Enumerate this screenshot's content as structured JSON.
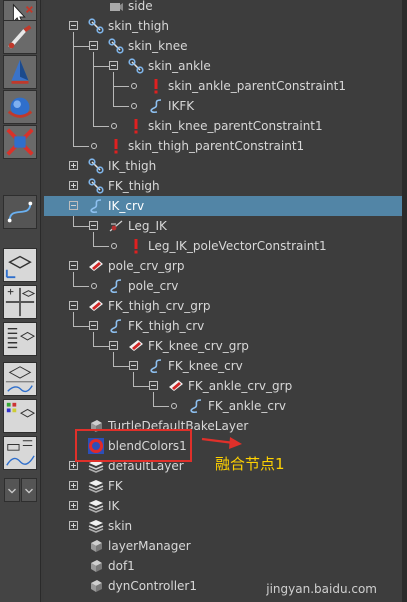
{
  "colors": {
    "panel_bg": "#3d3d3d",
    "selection": "#5285a6",
    "annotation_red": "#e0302a",
    "annotation_yellow": "#ffd200"
  },
  "outliner": {
    "rows": [
      {
        "label": "side",
        "icon": "camera-icon"
      },
      {
        "label": "skin_thigh",
        "icon": "joint-icon",
        "expanded": true
      },
      {
        "label": "skin_knee",
        "icon": "joint-icon",
        "expanded": true
      },
      {
        "label": "skin_ankle",
        "icon": "joint-icon",
        "expanded": true
      },
      {
        "label": "skin_ankle_parentConstraint1",
        "icon": "constraint-icon"
      },
      {
        "label": "IKFK",
        "icon": "curve-icon"
      },
      {
        "label": "skin_knee_parentConstraint1",
        "icon": "constraint-icon"
      },
      {
        "label": "skin_thigh_parentConstraint1",
        "icon": "constraint-icon"
      },
      {
        "label": "IK_thigh",
        "icon": "joint-icon",
        "expanded": false
      },
      {
        "label": "FK_thigh",
        "icon": "joint-icon",
        "expanded": false
      },
      {
        "label": "IK_crv",
        "icon": "curve-icon",
        "expanded": true,
        "selected": true
      },
      {
        "label": "Leg_IK",
        "icon": "ik-handle-icon",
        "expanded": true
      },
      {
        "label": "Leg_IK_poleVectorConstraint1",
        "icon": "constraint-icon"
      },
      {
        "label": "pole_crv_grp",
        "icon": "group-icon",
        "expanded": true
      },
      {
        "label": "pole_crv",
        "icon": "curve-icon"
      },
      {
        "label": "FK_thigh_crv_grp",
        "icon": "group-icon",
        "expanded": true
      },
      {
        "label": "FK_thigh_crv",
        "icon": "curve-icon",
        "expanded": true
      },
      {
        "label": "FK_knee_crv_grp",
        "icon": "group-icon",
        "expanded": true
      },
      {
        "label": "FK_knee_crv",
        "icon": "curve-icon",
        "expanded": true
      },
      {
        "label": "FK_ankle_crv_grp",
        "icon": "group-icon",
        "expanded": true
      },
      {
        "label": "FK_ankle_crv",
        "icon": "curve-icon"
      },
      {
        "label": "TurtleDefaultBakeLayer",
        "icon": "node-icon"
      },
      {
        "label": "blendColors1",
        "icon": "blend-colors-icon"
      },
      {
        "label": "defaultLayer",
        "icon": "layer-icon",
        "expanded": false
      },
      {
        "label": "FK",
        "icon": "layer-icon",
        "expanded": false
      },
      {
        "label": "IK",
        "icon": "layer-icon",
        "expanded": false
      },
      {
        "label": "skin",
        "icon": "layer-icon",
        "expanded": false
      },
      {
        "label": "layerManager",
        "icon": "node-icon"
      },
      {
        "label": "dof1",
        "icon": "node-icon"
      },
      {
        "label": "dynController1",
        "icon": "node-icon"
      }
    ]
  },
  "annotation": {
    "text": "融合节点1",
    "arrow_icon": "arrow-right-icon"
  },
  "watermark": {
    "text": "jingyan.baidu.com"
  },
  "toolbar": {
    "tools": [
      "select-icon",
      "paint-icon",
      "move-icon",
      "rotate-icon",
      "scale-icon",
      "curve-tool-icon",
      "layout-single-icon",
      "layout-four-icon",
      "layout-outliner-icon",
      "layout-graph-icon",
      "layout-hypershade-icon",
      "layout-graph-editor-icon",
      "toolbar-menu-icon"
    ]
  }
}
